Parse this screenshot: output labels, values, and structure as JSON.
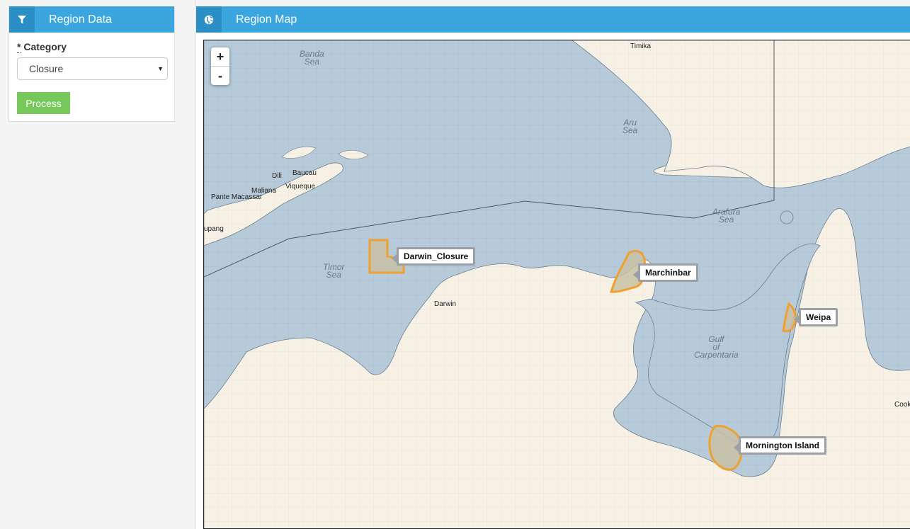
{
  "left_panel": {
    "title": "Region Data",
    "icon": "filter-icon",
    "category_label": "Category",
    "required_mark": "*",
    "category_value": "Closure",
    "process_label": "Process"
  },
  "right_panel": {
    "title": "Region Map",
    "icon": "globe-icon"
  },
  "map": {
    "zoom_in": "+",
    "zoom_out": "-",
    "places": {
      "timika": "Timika",
      "dili": "Dili",
      "baucau": "Baucau",
      "maliana": "Maliana",
      "viqueque": "Viqueque",
      "pante_macassar": "Pante Macassar",
      "kupang": "upang",
      "darwin": "Darwin",
      "cooktown": "Cook"
    },
    "seas": {
      "banda_1": "Banda",
      "banda_2": "Sea",
      "aru_1": "Aru",
      "aru_2": "Sea",
      "arafura_1": "Arafura",
      "arafura_2": "Sea",
      "timor_1": "Timor",
      "timor_2": "Sea",
      "gulf_1": "Gulf",
      "gulf_2": "of",
      "gulf_3": "Carpentaria"
    },
    "regions": [
      {
        "name": "Darwin_Closure"
      },
      {
        "name": "Marchinbar"
      },
      {
        "name": "Weipa"
      },
      {
        "name": "Mornington Island"
      }
    ],
    "colors": {
      "water": "#b6cad9",
      "land": "#f6f1e4",
      "region_stroke": "#f0a030",
      "header": "#3aa6dd"
    }
  }
}
